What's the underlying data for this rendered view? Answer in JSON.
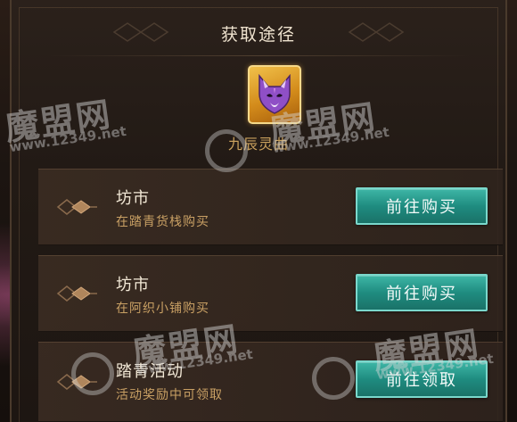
{
  "dialog": {
    "title": "获取途径"
  },
  "item": {
    "icon": "fox-mask-icon",
    "name": "九辰灵曲",
    "frame_color": "#e8a83a"
  },
  "sources": [
    {
      "title": "坊市",
      "description": "在踏青货栈购买",
      "button": "前往购买"
    },
    {
      "title": "坊市",
      "description": "在阿织小铺购买",
      "button": "前往购买"
    },
    {
      "title": "踏青活动",
      "description": "活动奖励中可领取",
      "button": "前往领取"
    }
  ],
  "watermarks": [
    {
      "brand": "魔盟网",
      "url": "www.12349.net"
    },
    {
      "brand": "魔盟网",
      "url": "www.12349.net"
    },
    {
      "brand": "魔盟网",
      "url": "www.12349.net"
    },
    {
      "brand": "魔盟网",
      "url": "www.12349.net"
    }
  ],
  "colors": {
    "button_teal": "#2a9a8c",
    "title_text": "#efe3cf",
    "desc_text": "#c9a064",
    "item_name": "#caa15d"
  }
}
